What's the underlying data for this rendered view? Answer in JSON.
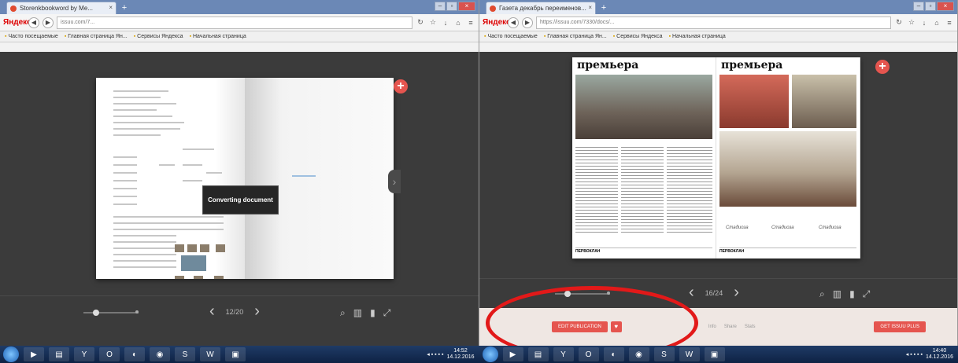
{
  "left": {
    "tab_title": "Storenkbookword by Me...",
    "logo": "Яндекс",
    "url": "issuu.com/7...",
    "bookmarks": [
      "Часто посещаемые",
      "Главная страница Ян...",
      "Сервисы Яндекса",
      "Начальная страница"
    ],
    "toast": "Converting document",
    "page_indicator": "12/20",
    "app_colors": {
      "viewer_bg": "#3b3b3b",
      "accent": "#e5554f"
    }
  },
  "right": {
    "tab_title": "Газета декабрь переименов...",
    "logo": "Яндекс",
    "url": "https://issuu.com/7330/docs/...",
    "bookmarks": [
      "Часто посещаемые",
      "Главная страница Ян...",
      "Сервисы Яндекса",
      "Начальная страница"
    ],
    "magazine_title_left": "премьера",
    "magazine_title_right": "премьера",
    "footer_brand": "ПЕРВОКЛАН",
    "signatures": [
      "Стадиоза",
      "Стадиоза",
      "Стадиоза"
    ],
    "page_indicator": "16/24",
    "footer": {
      "publish_button": "EDIT PUBLICATION",
      "heart_icon": "heart-icon",
      "links": [
        "Info",
        "Share",
        "Stats"
      ],
      "get_button": "GET ISSUU PLUS"
    }
  },
  "taskbar": {
    "time_left": "14:52",
    "date_left": "14.12.2016",
    "time_right": "14:40",
    "date_right": "14.12.2016"
  }
}
